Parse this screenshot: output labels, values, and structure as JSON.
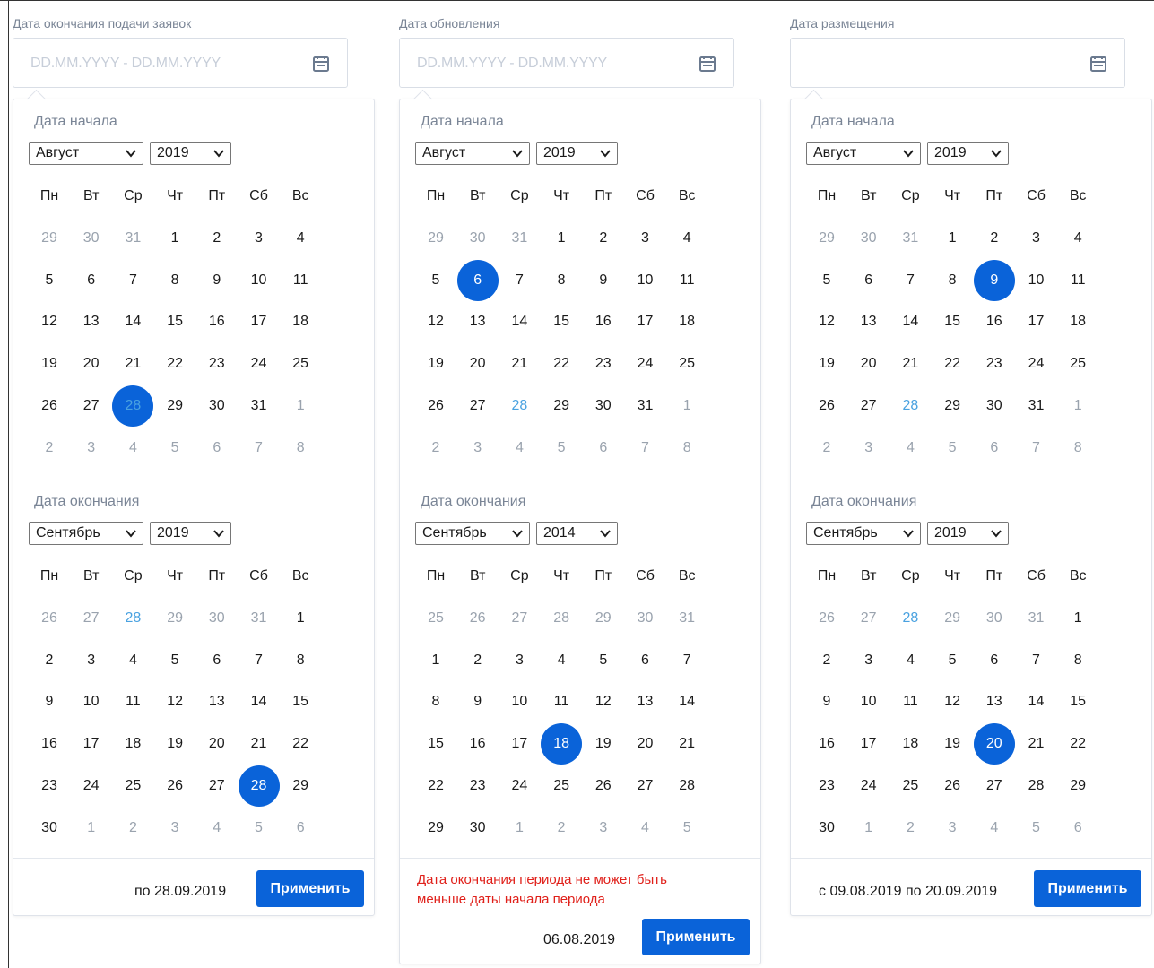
{
  "colors": {
    "accent": "#0a63d9",
    "error": "#e0201a",
    "today": "#4aa2e0",
    "muted": "#9aa3ae"
  },
  "weekdays": [
    "Пн",
    "Вт",
    "Ср",
    "Чт",
    "Пт",
    "Сб",
    "Вс"
  ],
  "pickers": [
    {
      "field_label": "Дата окончания подачи заявок",
      "input_value": "DD.MM.YYYY - DD.MM.YYYY",
      "start": {
        "label": "Дата начала",
        "month": "Август",
        "year": "2019",
        "days": [
          [
            [
              "29",
              "o"
            ],
            [
              "30",
              "o"
            ],
            [
              "31",
              "o"
            ],
            [
              "1",
              ""
            ],
            [
              "2",
              ""
            ],
            [
              "3",
              ""
            ],
            [
              "4",
              ""
            ]
          ],
          [
            [
              "5",
              ""
            ],
            [
              "6",
              ""
            ],
            [
              "7",
              ""
            ],
            [
              "8",
              ""
            ],
            [
              "9",
              ""
            ],
            [
              "10",
              ""
            ],
            [
              "11",
              ""
            ]
          ],
          [
            [
              "12",
              ""
            ],
            [
              "13",
              ""
            ],
            [
              "14",
              ""
            ],
            [
              "15",
              ""
            ],
            [
              "16",
              ""
            ],
            [
              "17",
              ""
            ],
            [
              "18",
              ""
            ]
          ],
          [
            [
              "19",
              ""
            ],
            [
              "20",
              ""
            ],
            [
              "21",
              ""
            ],
            [
              "22",
              ""
            ],
            [
              "23",
              ""
            ],
            [
              "24",
              ""
            ],
            [
              "25",
              ""
            ]
          ],
          [
            [
              "26",
              ""
            ],
            [
              "27",
              ""
            ],
            [
              "28",
              "st"
            ],
            [
              "29",
              ""
            ],
            [
              "30",
              ""
            ],
            [
              "31",
              ""
            ],
            [
              "1",
              "o"
            ]
          ],
          [
            [
              "2",
              "o"
            ],
            [
              "3",
              "o"
            ],
            [
              "4",
              "o"
            ],
            [
              "5",
              "o"
            ],
            [
              "6",
              "o"
            ],
            [
              "7",
              "o"
            ],
            [
              "8",
              "o"
            ]
          ]
        ]
      },
      "end": {
        "label": "Дата окончания",
        "month": "Сентябрь",
        "year": "2019",
        "days": [
          [
            [
              "26",
              "o"
            ],
            [
              "27",
              "o"
            ],
            [
              "28",
              "t"
            ],
            [
              "29",
              "o"
            ],
            [
              "30",
              "o"
            ],
            [
              "31",
              "o"
            ],
            [
              "1",
              ""
            ]
          ],
          [
            [
              "2",
              ""
            ],
            [
              "3",
              ""
            ],
            [
              "4",
              ""
            ],
            [
              "5",
              ""
            ],
            [
              "6",
              ""
            ],
            [
              "7",
              ""
            ],
            [
              "8",
              ""
            ]
          ],
          [
            [
              "9",
              ""
            ],
            [
              "10",
              ""
            ],
            [
              "11",
              ""
            ],
            [
              "12",
              ""
            ],
            [
              "13",
              ""
            ],
            [
              "14",
              ""
            ],
            [
              "15",
              ""
            ]
          ],
          [
            [
              "16",
              ""
            ],
            [
              "17",
              ""
            ],
            [
              "18",
              ""
            ],
            [
              "19",
              ""
            ],
            [
              "20",
              ""
            ],
            [
              "21",
              ""
            ],
            [
              "22",
              ""
            ]
          ],
          [
            [
              "23",
              ""
            ],
            [
              "24",
              ""
            ],
            [
              "25",
              ""
            ],
            [
              "26",
              ""
            ],
            [
              "27",
              ""
            ],
            [
              "28",
              "s"
            ],
            [
              "29",
              ""
            ]
          ],
          [
            [
              "30",
              ""
            ],
            [
              "1",
              "o"
            ],
            [
              "2",
              "o"
            ],
            [
              "3",
              "o"
            ],
            [
              "4",
              "o"
            ],
            [
              "5",
              "o"
            ],
            [
              "6",
              "o"
            ]
          ]
        ]
      },
      "footer_text": "по 28.09.2019",
      "error": "",
      "apply_label": "Применить"
    },
    {
      "field_label": "Дата обновления",
      "input_value": "DD.MM.YYYY - DD.MM.YYYY",
      "start": {
        "label": "Дата начала",
        "month": "Август",
        "year": "2019",
        "days": [
          [
            [
              "29",
              "o"
            ],
            [
              "30",
              "o"
            ],
            [
              "31",
              "o"
            ],
            [
              "1",
              ""
            ],
            [
              "2",
              ""
            ],
            [
              "3",
              ""
            ],
            [
              "4",
              ""
            ]
          ],
          [
            [
              "5",
              ""
            ],
            [
              "6",
              "s"
            ],
            [
              "7",
              ""
            ],
            [
              "8",
              ""
            ],
            [
              "9",
              ""
            ],
            [
              "10",
              ""
            ],
            [
              "11",
              ""
            ]
          ],
          [
            [
              "12",
              ""
            ],
            [
              "13",
              ""
            ],
            [
              "14",
              ""
            ],
            [
              "15",
              ""
            ],
            [
              "16",
              ""
            ],
            [
              "17",
              ""
            ],
            [
              "18",
              ""
            ]
          ],
          [
            [
              "19",
              ""
            ],
            [
              "20",
              ""
            ],
            [
              "21",
              ""
            ],
            [
              "22",
              ""
            ],
            [
              "23",
              ""
            ],
            [
              "24",
              ""
            ],
            [
              "25",
              ""
            ]
          ],
          [
            [
              "26",
              ""
            ],
            [
              "27",
              ""
            ],
            [
              "28",
              "t"
            ],
            [
              "29",
              ""
            ],
            [
              "30",
              ""
            ],
            [
              "31",
              ""
            ],
            [
              "1",
              "o"
            ]
          ],
          [
            [
              "2",
              "o"
            ],
            [
              "3",
              "o"
            ],
            [
              "4",
              "o"
            ],
            [
              "5",
              "o"
            ],
            [
              "6",
              "o"
            ],
            [
              "7",
              "o"
            ],
            [
              "8",
              "o"
            ]
          ]
        ]
      },
      "end": {
        "label": "Дата окончания",
        "month": "Сентябрь",
        "year": "2014",
        "days": [
          [
            [
              "25",
              "o"
            ],
            [
              "26",
              "o"
            ],
            [
              "27",
              "o"
            ],
            [
              "28",
              "o"
            ],
            [
              "29",
              "o"
            ],
            [
              "30",
              "o"
            ],
            [
              "31",
              "o"
            ]
          ],
          [
            [
              "1",
              ""
            ],
            [
              "2",
              ""
            ],
            [
              "3",
              ""
            ],
            [
              "4",
              ""
            ],
            [
              "5",
              ""
            ],
            [
              "6",
              ""
            ],
            [
              "7",
              ""
            ]
          ],
          [
            [
              "8",
              ""
            ],
            [
              "9",
              ""
            ],
            [
              "10",
              ""
            ],
            [
              "11",
              ""
            ],
            [
              "12",
              ""
            ],
            [
              "13",
              ""
            ],
            [
              "14",
              ""
            ]
          ],
          [
            [
              "15",
              ""
            ],
            [
              "16",
              ""
            ],
            [
              "17",
              ""
            ],
            [
              "18",
              "s"
            ],
            [
              "19",
              ""
            ],
            [
              "20",
              ""
            ],
            [
              "21",
              ""
            ]
          ],
          [
            [
              "22",
              ""
            ],
            [
              "23",
              ""
            ],
            [
              "24",
              ""
            ],
            [
              "25",
              ""
            ],
            [
              "26",
              ""
            ],
            [
              "27",
              ""
            ],
            [
              "28",
              ""
            ]
          ],
          [
            [
              "29",
              ""
            ],
            [
              "30",
              ""
            ],
            [
              "1",
              "o"
            ],
            [
              "2",
              "o"
            ],
            [
              "3",
              "o"
            ],
            [
              "4",
              "o"
            ],
            [
              "5",
              "o"
            ]
          ]
        ]
      },
      "footer_text": "06.08.2019",
      "error": "Дата окончания периода не может быть меньше даты начала периода",
      "apply_label": "Применить"
    },
    {
      "field_label": "Дата размещения",
      "input_value": "",
      "start": {
        "label": "Дата начала",
        "month": "Август",
        "year": "2019",
        "days": [
          [
            [
              "29",
              "o"
            ],
            [
              "30",
              "o"
            ],
            [
              "31",
              "o"
            ],
            [
              "1",
              ""
            ],
            [
              "2",
              ""
            ],
            [
              "3",
              ""
            ],
            [
              "4",
              ""
            ]
          ],
          [
            [
              "5",
              ""
            ],
            [
              "6",
              ""
            ],
            [
              "7",
              ""
            ],
            [
              "8",
              ""
            ],
            [
              "9",
              "s"
            ],
            [
              "10",
              ""
            ],
            [
              "11",
              ""
            ]
          ],
          [
            [
              "12",
              ""
            ],
            [
              "13",
              ""
            ],
            [
              "14",
              ""
            ],
            [
              "15",
              ""
            ],
            [
              "16",
              ""
            ],
            [
              "17",
              ""
            ],
            [
              "18",
              ""
            ]
          ],
          [
            [
              "19",
              ""
            ],
            [
              "20",
              ""
            ],
            [
              "21",
              ""
            ],
            [
              "22",
              ""
            ],
            [
              "23",
              ""
            ],
            [
              "24",
              ""
            ],
            [
              "25",
              ""
            ]
          ],
          [
            [
              "26",
              ""
            ],
            [
              "27",
              ""
            ],
            [
              "28",
              "t"
            ],
            [
              "29",
              ""
            ],
            [
              "30",
              ""
            ],
            [
              "31",
              ""
            ],
            [
              "1",
              "o"
            ]
          ],
          [
            [
              "2",
              "o"
            ],
            [
              "3",
              "o"
            ],
            [
              "4",
              "o"
            ],
            [
              "5",
              "o"
            ],
            [
              "6",
              "o"
            ],
            [
              "7",
              "o"
            ],
            [
              "8",
              "o"
            ]
          ]
        ]
      },
      "end": {
        "label": "Дата окончания",
        "month": "Сентябрь",
        "year": "2019",
        "days": [
          [
            [
              "26",
              "o"
            ],
            [
              "27",
              "o"
            ],
            [
              "28",
              "t"
            ],
            [
              "29",
              "o"
            ],
            [
              "30",
              "o"
            ],
            [
              "31",
              "o"
            ],
            [
              "1",
              ""
            ]
          ],
          [
            [
              "2",
              ""
            ],
            [
              "3",
              ""
            ],
            [
              "4",
              ""
            ],
            [
              "5",
              ""
            ],
            [
              "6",
              ""
            ],
            [
              "7",
              ""
            ],
            [
              "8",
              ""
            ]
          ],
          [
            [
              "9",
              ""
            ],
            [
              "10",
              ""
            ],
            [
              "11",
              ""
            ],
            [
              "12",
              ""
            ],
            [
              "13",
              ""
            ],
            [
              "14",
              ""
            ],
            [
              "15",
              ""
            ]
          ],
          [
            [
              "16",
              ""
            ],
            [
              "17",
              ""
            ],
            [
              "18",
              ""
            ],
            [
              "19",
              ""
            ],
            [
              "20",
              "s"
            ],
            [
              "21",
              ""
            ],
            [
              "22",
              ""
            ]
          ],
          [
            [
              "23",
              ""
            ],
            [
              "24",
              ""
            ],
            [
              "25",
              ""
            ],
            [
              "26",
              ""
            ],
            [
              "27",
              ""
            ],
            [
              "28",
              ""
            ],
            [
              "29",
              ""
            ]
          ],
          [
            [
              "30",
              ""
            ],
            [
              "1",
              "o"
            ],
            [
              "2",
              "o"
            ],
            [
              "3",
              "o"
            ],
            [
              "4",
              "o"
            ],
            [
              "5",
              "o"
            ],
            [
              "6",
              "o"
            ]
          ]
        ]
      },
      "footer_text": "с 09.08.2019 по 20.09.2019",
      "error": "",
      "apply_label": "Применить"
    }
  ]
}
